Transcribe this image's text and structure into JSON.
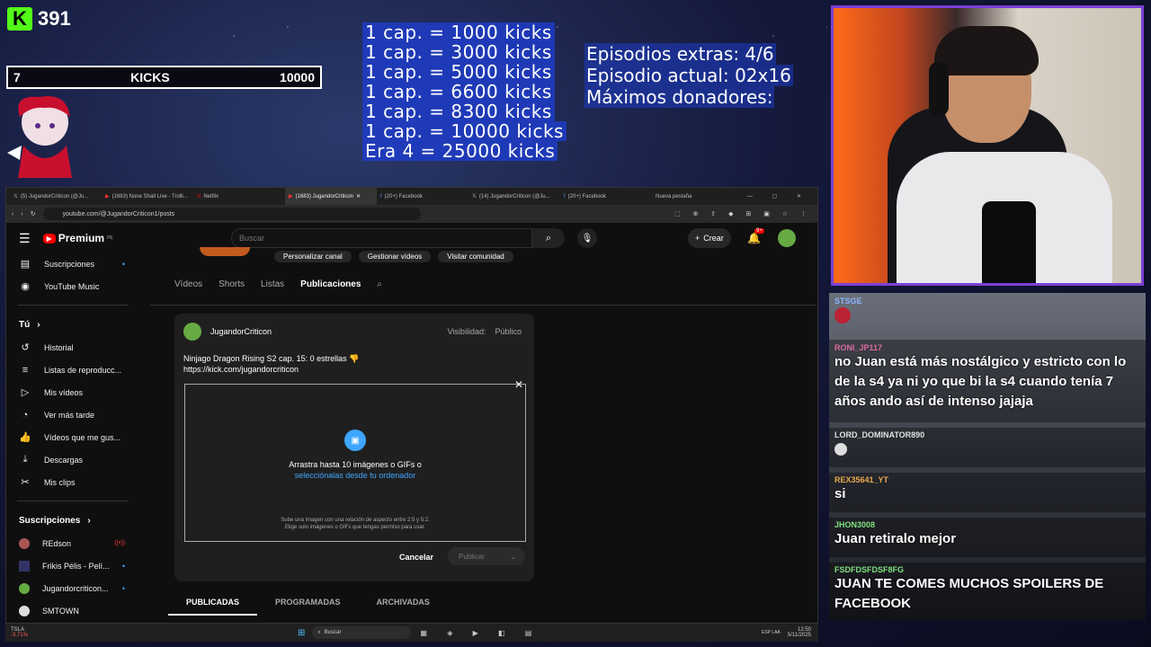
{
  "overlay": {
    "kick_count": "391",
    "goal_current": "7",
    "goal_label": "KICKS",
    "goal_target": "10000",
    "kick_goals": [
      "1 cap. = 1000 kicks",
      "1 cap. = 3000 kicks",
      "1 cap. = 5000 kicks",
      "1 cap. = 6600 kicks",
      "1 cap. = 8300 kicks",
      "1 cap. = 10000 kicks",
      "Era 4 = 25000 kicks"
    ],
    "episodes": [
      "Episodios extras: 4/6",
      "Episodio actual: 02x16",
      "Máximos donadores:"
    ]
  },
  "browser": {
    "tabs": [
      {
        "label": "(5) JugandorCriticon (@Ju..."
      },
      {
        "label": "(1683) None Shall Live - Trolli..."
      },
      {
        "label": "Netflix"
      },
      {
        "label": "(1683) JugandorCriticon",
        "active": true
      },
      {
        "label": "(20+) Facebook"
      },
      {
        "label": "(14) JugandorCriticon (@Ju..."
      },
      {
        "label": "(20+) Facebook"
      },
      {
        "label": "Nueva pestaña"
      }
    ],
    "url": "youtube.com/@JugandorCriticon1/posts"
  },
  "youtube": {
    "logo": "Premium",
    "logo_region": "PE",
    "search_placeholder": "Buscar",
    "create_label": "Crear",
    "notif_count": "9+",
    "channel_buttons": [
      "Personalizar canal",
      "Gestionar vídeos",
      "Visitar comunidad"
    ],
    "channel_tabs": [
      "Vídeos",
      "Shorts",
      "Listas",
      "Publicaciones"
    ],
    "sidebar": {
      "top": [
        {
          "label": "Suscripciones",
          "icon": "subscriptions-icon"
        },
        {
          "label": "YouTube Music",
          "icon": "music-icon"
        }
      ],
      "you_header": "Tú",
      "you_items": [
        {
          "label": "Historial"
        },
        {
          "label": "Listas de reproducc..."
        },
        {
          "label": "Mis vídeos"
        },
        {
          "label": "Ver más tarde"
        },
        {
          "label": "Vídeos que me gus..."
        },
        {
          "label": "Descargas"
        },
        {
          "label": "Mis clips"
        }
      ],
      "subs_header": "Suscripciones",
      "subs": [
        {
          "label": "REdson"
        },
        {
          "label": "Frikis Pélis - Pelí..."
        },
        {
          "label": "Jugandorcriticon..."
        },
        {
          "label": "SMTOWN"
        }
      ]
    },
    "post": {
      "channel": "JugandorCriticon",
      "visibility_label": "Visibilidad:",
      "visibility_value": "Público",
      "text_line1": "Ninjago Dragon Rising S2 cap. 15: 0 estrellas 👎",
      "text_line2": "https://kick.com/jugandorcriticon",
      "drop_title": "Arrastra hasta 10 imágenes o GIFs o",
      "drop_link": "selecciónalas desde tu ordenador",
      "drop_note1": "Sube una imagen con una relación de aspecto entre 2:5 y 5:2.",
      "drop_note2": "Elige solo imágenes o GIFs que tengas permiso para usar.",
      "cancel": "Cancelar",
      "publish": "Publicar"
    },
    "bottom_tabs": [
      "PUBLICADAS",
      "PROGRAMADAS",
      "ARCHIVADAS"
    ]
  },
  "taskbar": {
    "search": "Buscar",
    "stock": "TSLA",
    "stock_change": "-3.71%",
    "lang": "ESP LAA",
    "time": "12:50",
    "date": "5/11/2025"
  },
  "chat": [
    {
      "user": "STSGE",
      "text": ""
    },
    {
      "user": "RONI_JP117",
      "text": "no Juan está más nostálgico y estricto con lo de la s4 ya ni yo que bi la s4 cuando tenía 7 años ando así de intenso jajaja",
      "color": "#d96aa0"
    },
    {
      "user": "LORD_DOMINATOR890",
      "text": "",
      "color": "#e0e0e0"
    },
    {
      "user": "REX35641_YT",
      "text": "si",
      "color": "#e7a84a"
    },
    {
      "user": "JHON3008",
      "text": "Juan retiralo mejor",
      "color": "#7fe07f"
    },
    {
      "user": "FSDFDSFDSF8FG",
      "text": "JUAN TE COMES MUCHOS SPOILERS DE FACEBOOK",
      "color": "#7fe07f"
    }
  ]
}
